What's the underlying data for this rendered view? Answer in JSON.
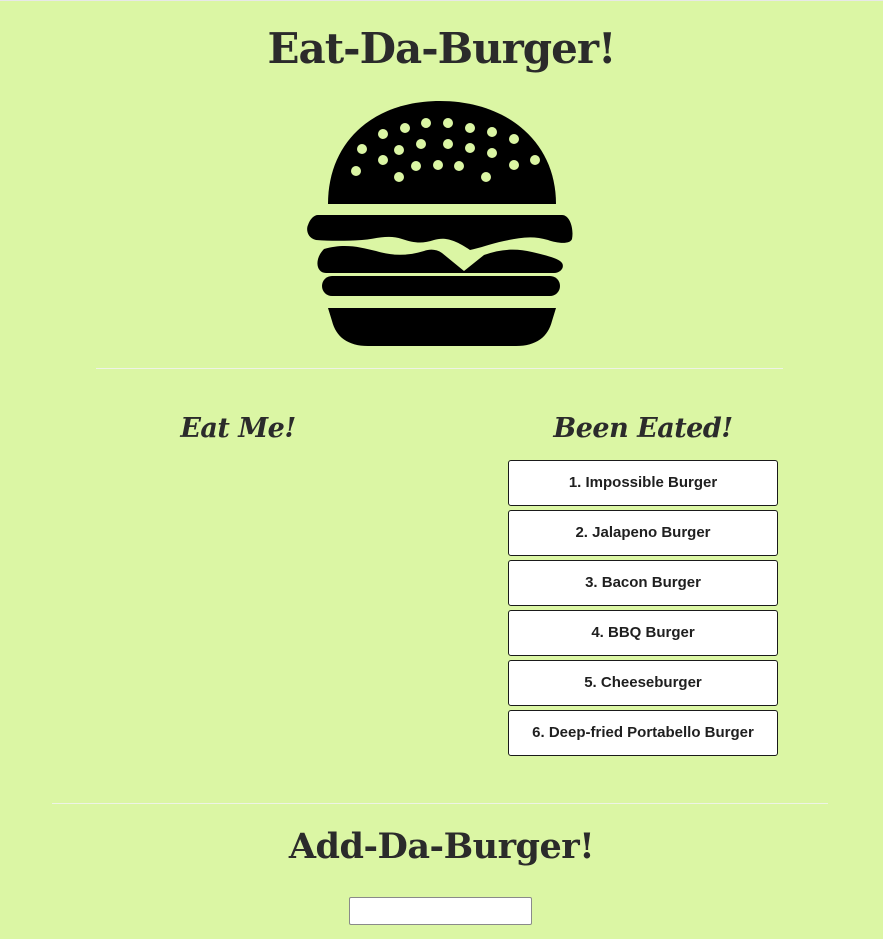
{
  "header": {
    "title": "Eat-Da-Burger!",
    "logo_icon": "burger-icon",
    "logo_color": "#000000"
  },
  "columns": {
    "uneaten_title": "Eat Me!",
    "eaten_title": "Been Eated!",
    "uneaten_items": [],
    "eaten_items": [
      "1. Impossible Burger",
      "2. Jalapeno Burger",
      "3. Bacon Burger",
      "4. BBQ Burger",
      "5. Cheeseburger",
      "6. Deep-fried Portabello Burger"
    ]
  },
  "add_form": {
    "title": "Add-Da-Burger!",
    "input_value": "",
    "input_placeholder": ""
  },
  "colors": {
    "background": "#dbf6a4",
    "heading": "#2b2b2b",
    "button_background": "#ffffff"
  }
}
